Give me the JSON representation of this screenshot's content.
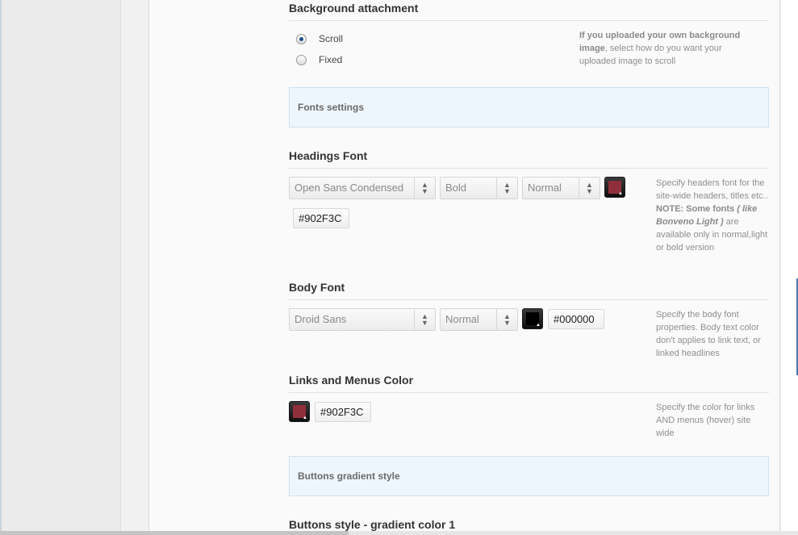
{
  "background_attachment": {
    "title": "Background attachment",
    "options": [
      {
        "label": "Scroll",
        "checked": true
      },
      {
        "label": "Fixed",
        "checked": false
      }
    ],
    "desc_bold": "If you uploaded your own background image",
    "desc_rest": ", select how do you want your uploaded image to scroll"
  },
  "fonts_settings": {
    "label": "Fonts settings"
  },
  "headings_font": {
    "title": "Headings Font",
    "family": "Open Sans Condensed",
    "weight": "Bold",
    "style": "Normal",
    "color_hex": "#902F3C",
    "desc_1": "Specify headers font for the site-wide headers, titles etc..",
    "desc_note_label": "NOTE: Some fonts ",
    "desc_note_em": "( like Bonveno Light )",
    "desc_note_rest": " are available only in normal,light or bold version"
  },
  "body_font": {
    "title": "Body Font",
    "family": "Droid Sans",
    "weight": "Normal",
    "color_hex": "#000000",
    "desc": "Specify the body font properties. Body text color don't applies to link text, or linked headlines"
  },
  "links_color": {
    "title": "Links and Menus Color",
    "color_hex": "#902F3C",
    "desc": "Specify the color for links AND menus (hover) site wide"
  },
  "buttons_gradient": {
    "label": "Buttons gradient style"
  },
  "buttons_color1": {
    "title": "Buttons style - gradient color 1"
  },
  "colors": {
    "accent_wine": "#902F3C",
    "black": "#000000",
    "info_bg": "#EEF6FD",
    "info_border": "#CFE2F3"
  },
  "icons": {
    "select_arrow": "up-down-chevron-icon",
    "picker_corner": "triangle-up-icon"
  }
}
